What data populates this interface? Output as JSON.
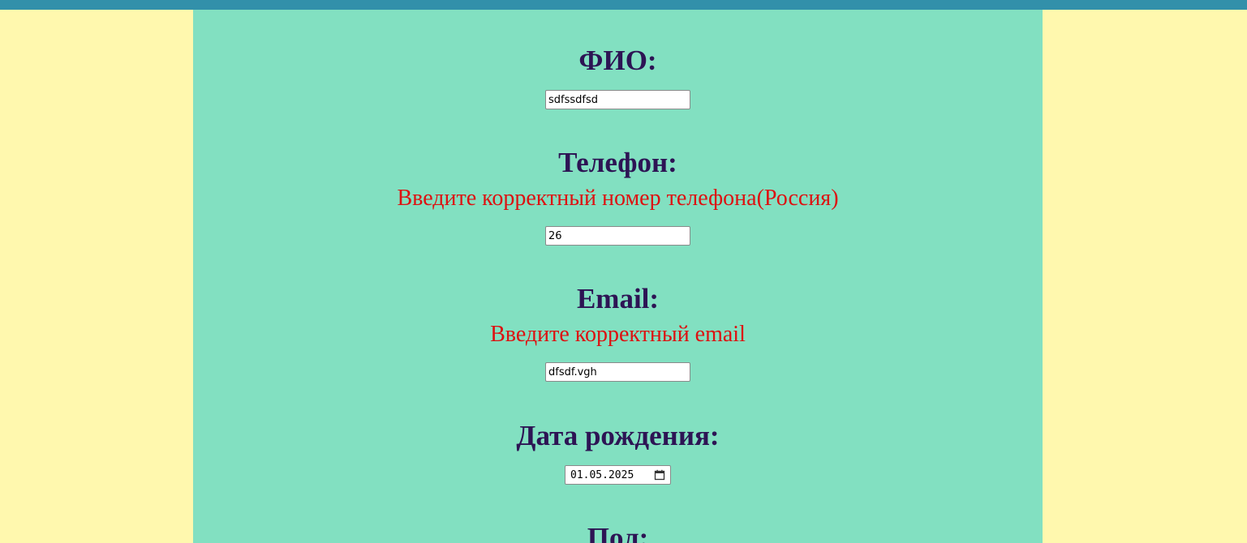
{
  "form": {
    "fio": {
      "label": "ФИО:",
      "value": "sdfssdfsd"
    },
    "phone": {
      "label": "Телефон:",
      "error": "Введите корректный номер телефона(Россия)",
      "value": "26"
    },
    "email": {
      "label": "Email:",
      "error": "Введите корректный email",
      "value": "dfsdf.vgh"
    },
    "birthdate": {
      "label": "Дата рождения:",
      "day": "01",
      "month": "05",
      "year": "2025",
      "separator": "."
    },
    "gender": {
      "label": "Пол:"
    }
  },
  "colors": {
    "page_background": "#fff8ae",
    "top_bar": "#3290aa",
    "panel_background": "#82e0c1",
    "label_text": "#2d1454",
    "error_text": "#dd1111"
  },
  "icons": {
    "date_picker": "calendar-icon"
  }
}
